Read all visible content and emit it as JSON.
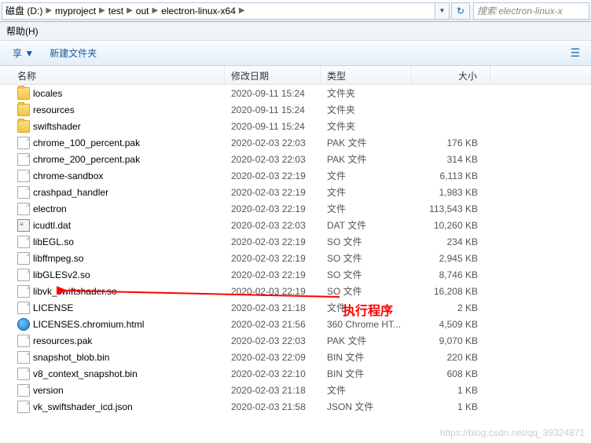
{
  "breadcrumb": {
    "disk": "磁盘 (D:)",
    "segments": [
      "myproject",
      "test",
      "out",
      "electron-linux-x64"
    ]
  },
  "search": {
    "placeholder": "搜索 electron-linux-x"
  },
  "menu": {
    "help": "帮助(H)"
  },
  "toolbar": {
    "share": "享 ▼",
    "new_folder": "新建文件夹"
  },
  "columns": {
    "name": "名称",
    "date": "修改日期",
    "type": "类型",
    "size": "大小"
  },
  "annotation": "执行程序",
  "watermark": "https://blog.csdn.net/qq_39324871",
  "files": [
    {
      "name": "locales",
      "date": "2020-09-11 15:24",
      "type": "文件夹",
      "size": "",
      "icon": "folder"
    },
    {
      "name": "resources",
      "date": "2020-09-11 15:24",
      "type": "文件夹",
      "size": "",
      "icon": "folder"
    },
    {
      "name": "swiftshader",
      "date": "2020-09-11 15:24",
      "type": "文件夹",
      "size": "",
      "icon": "folder"
    },
    {
      "name": "chrome_100_percent.pak",
      "date": "2020-02-03 22:03",
      "type": "PAK 文件",
      "size": "176 KB",
      "icon": "file"
    },
    {
      "name": "chrome_200_percent.pak",
      "date": "2020-02-03 22:03",
      "type": "PAK 文件",
      "size": "314 KB",
      "icon": "file"
    },
    {
      "name": "chrome-sandbox",
      "date": "2020-02-03 22:19",
      "type": "文件",
      "size": "6,113 KB",
      "icon": "file"
    },
    {
      "name": "crashpad_handler",
      "date": "2020-02-03 22:19",
      "type": "文件",
      "size": "1,983 KB",
      "icon": "file"
    },
    {
      "name": "electron",
      "date": "2020-02-03 22:19",
      "type": "文件",
      "size": "113,543 KB",
      "icon": "file"
    },
    {
      "name": "icudtl.dat",
      "date": "2020-02-03 22:03",
      "type": "DAT 文件",
      "size": "10,260 KB",
      "icon": "dat"
    },
    {
      "name": "libEGL.so",
      "date": "2020-02-03 22:19",
      "type": "SO 文件",
      "size": "234 KB",
      "icon": "file"
    },
    {
      "name": "libffmpeg.so",
      "date": "2020-02-03 22:19",
      "type": "SO 文件",
      "size": "2,945 KB",
      "icon": "file"
    },
    {
      "name": "libGLESv2.so",
      "date": "2020-02-03 22:19",
      "type": "SO 文件",
      "size": "8,746 KB",
      "icon": "file"
    },
    {
      "name": "libvk_swiftshader.so",
      "date": "2020-02-03 22:19",
      "type": "SO 文件",
      "size": "16,208 KB",
      "icon": "file"
    },
    {
      "name": "LICENSE",
      "date": "2020-02-03 21:18",
      "type": "文件",
      "size": "2 KB",
      "icon": "file"
    },
    {
      "name": "LICENSES.chromium.html",
      "date": "2020-02-03 21:56",
      "type": "360 Chrome HT...",
      "size": "4,509 KB",
      "icon": "html"
    },
    {
      "name": "resources.pak",
      "date": "2020-02-03 22:03",
      "type": "PAK 文件",
      "size": "9,070 KB",
      "icon": "file"
    },
    {
      "name": "snapshot_blob.bin",
      "date": "2020-02-03 22:09",
      "type": "BIN 文件",
      "size": "220 KB",
      "icon": "file"
    },
    {
      "name": "v8_context_snapshot.bin",
      "date": "2020-02-03 22:10",
      "type": "BIN 文件",
      "size": "608 KB",
      "icon": "file"
    },
    {
      "name": "version",
      "date": "2020-02-03 21:18",
      "type": "文件",
      "size": "1 KB",
      "icon": "file"
    },
    {
      "name": "vk_swiftshader_icd.json",
      "date": "2020-02-03 21:58",
      "type": "JSON 文件",
      "size": "1 KB",
      "icon": "file"
    }
  ]
}
